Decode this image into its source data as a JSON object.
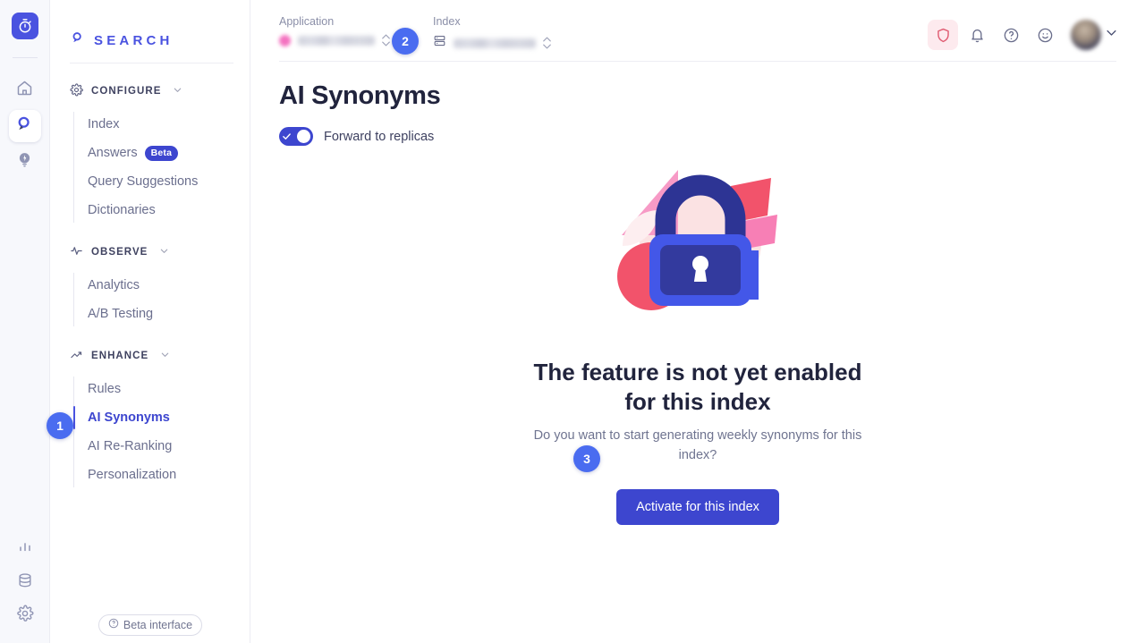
{
  "rail": {
    "logo_icon": "stopwatch-logo-icon",
    "items": [
      {
        "icon": "home-icon",
        "name": "home",
        "active": false
      },
      {
        "icon": "search-icon",
        "name": "search",
        "active": true
      },
      {
        "icon": "recommend-bulb-icon",
        "name": "recommend",
        "active": false
      }
    ],
    "bottom_items": [
      {
        "icon": "bar-chart-icon",
        "name": "analytics"
      },
      {
        "icon": "database-icon",
        "name": "data-sources"
      },
      {
        "icon": "gear-icon",
        "name": "settings"
      }
    ]
  },
  "sidebar": {
    "brand": "SEARCH",
    "brand_icon": "search-pin-icon",
    "sections": [
      {
        "label": "CONFIGURE",
        "icon": "gear-icon",
        "items": [
          {
            "label": "Index",
            "badge": null,
            "active": false
          },
          {
            "label": "Answers",
            "badge": "Beta",
            "active": false
          },
          {
            "label": "Query Suggestions",
            "badge": null,
            "active": false
          },
          {
            "label": "Dictionaries",
            "badge": null,
            "active": false
          }
        ]
      },
      {
        "label": "OBSERVE",
        "icon": "pulse-icon",
        "items": [
          {
            "label": "Analytics",
            "badge": null,
            "active": false
          },
          {
            "label": "A/B Testing",
            "badge": null,
            "active": false
          }
        ]
      },
      {
        "label": "ENHANCE",
        "icon": "trending-up-icon",
        "items": [
          {
            "label": "Rules",
            "badge": null,
            "active": false
          },
          {
            "label": "AI Synonyms",
            "badge": null,
            "active": true
          },
          {
            "label": "AI Re-Ranking",
            "badge": null,
            "active": false
          },
          {
            "label": "Personalization",
            "badge": null,
            "active": false
          }
        ]
      }
    ],
    "footer": {
      "label": "Beta interface",
      "icon": "help-circle-icon"
    }
  },
  "topbar": {
    "application": {
      "label": "Application",
      "value": "",
      "redacted": true,
      "icon": "app-dot-icon"
    },
    "index": {
      "label": "Index",
      "value": "",
      "redacted": true,
      "icon": "index-stack-icon"
    },
    "icons": [
      {
        "name": "shield-icon",
        "highlighted": true
      },
      {
        "name": "bell-icon",
        "highlighted": false
      },
      {
        "name": "help-circle-icon",
        "highlighted": false
      },
      {
        "name": "smiley-icon",
        "highlighted": false
      }
    ],
    "avatar": {
      "name": "user-avatar",
      "redacted": true
    },
    "chevron": "chevron-down-icon"
  },
  "page": {
    "title": "AI Synonyms",
    "forward_toggle": {
      "label": "Forward to replicas",
      "on": true
    }
  },
  "empty_state": {
    "illustration": "padlock-illustration",
    "title_line1": "The feature is not yet enabled",
    "title_line2": "for this index",
    "subtitle": "Do you want to start generating weekly synonyms for this index?",
    "cta_label": "Activate for this index"
  },
  "steps": [
    {
      "number": "1",
      "target": "sidebar-item-ai-synonyms"
    },
    {
      "number": "2",
      "target": "index-selector"
    },
    {
      "number": "3",
      "target": "activate-button"
    }
  ],
  "colors": {
    "accent": "#3d46cf",
    "step_badge": "#4a6cf0",
    "beta_badge": "#3d46cf",
    "alert_bg": "#fdeaee",
    "lock_blue": "#3d46cf",
    "lock_body": "#2d3494",
    "pink": "#f9a8c9",
    "coral": "#f2536b",
    "blush": "#fce0e3"
  }
}
